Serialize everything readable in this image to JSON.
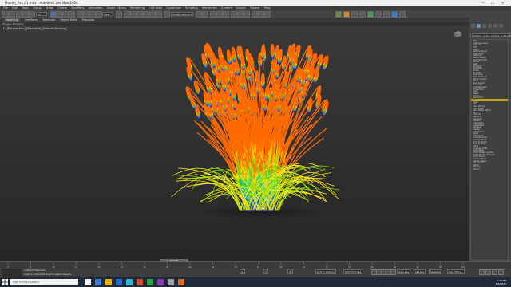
{
  "window": {
    "title": "Mantel_Grs_01.max - Autodesk 3ds Max 2020"
  },
  "menubar": {
    "items": [
      "File",
      "Edit",
      "Tools",
      "Group",
      "Views",
      "Create",
      "Modifiers",
      "Animation",
      "Graph Editors",
      "Rendering",
      "Civil View",
      "Customize",
      "Scripting",
      "Interactive",
      "Content",
      "Arnold",
      "Octane",
      "Help"
    ]
  },
  "toolbar": {
    "selection_filter": "All",
    "view_combo": "View",
    "selection_set": "Create Selection Se",
    "workspace": "Workspaces: Default"
  },
  "ribbon": {
    "tabs": [
      "Modeling",
      "Freeform",
      "Selection",
      "Object Paint",
      "Populate"
    ],
    "active": "Modeling",
    "sub": "Polygon Modeling"
  },
  "viewport": {
    "label": "[+] [Perspective] [Standard] [Default Shading]"
  },
  "command_panel": {
    "search_value": "Modifier_Grass_Octane_Subsampler",
    "list_items": [
      "Sky",
      "Displacement",
      "Extrude",
      "FFD",
      "Lathe",
      "Lattice Warp",
      "MapScaler",
      "Material",
      "Mesh Select",
      "MeshSmooth",
      "Mirror",
      "Melt",
      "Morpher",
      "MultiRes",
      "Noise",
      "Normal",
      "Optimize",
      "Path Deform",
      "Patch Select",
      "Pivot",
      "Poly Select",
      "Preserve",
      "ProOptimizer",
      "Projection",
      "Push",
      "Relax",
      "Ripple",
      "Selection",
      "Skew",
      "Shell",
      "Skin",
      "Skin Morph",
      "Skin Wrap",
      "Skin Wrap Patch",
      "Slice",
      "Smooth",
      "Spherify",
      "Squeeze",
      "Stretch",
      "Subdivide",
      "Substitute",
      "Surface",
      "Sweep",
      "Symmetry",
      "Taper",
      "Tessellate",
      "Turbosmooth",
      "Turn to Mesh",
      "Turn to Patch",
      "Turn to Poly",
      "Twist",
      "Unwrap UVW",
      "UVW Map",
      "UVW Mapping Add",
      "UVW Mapping Clear",
      "UVW Xform",
      "Vertex Paint",
      "Vertex Weld",
      "Vol. Select",
      "Wave",
      "Welder",
      "XForm"
    ],
    "selected_index": 28
  },
  "timeline": {
    "slider_label": "0 / 100",
    "ticks": [
      "0",
      "5",
      "10",
      "15",
      "20",
      "25",
      "30",
      "35",
      "40",
      "45",
      "50",
      "55",
      "60",
      "65",
      "70",
      "75",
      "80",
      "85",
      "90",
      "95",
      "100"
    ]
  },
  "status": {
    "selection": "1 Object Selected",
    "prompt": "Click or click-and-drag to select objects",
    "x_label": "X:",
    "y_label": "Y:",
    "z_label": "Z:",
    "grid": "Grid = 10,0cm",
    "add_time_tag": "Add Time Tag",
    "autokey": "Auto Key",
    "set_key": "Set Key",
    "selected": "Selected",
    "key_filters": "Key Filters..."
  },
  "taskbar": {
    "search_placeholder": "Type here to search",
    "time": "4:28 PM",
    "date": "4/9/2020",
    "app_colors": [
      "#ffffff",
      "#3a7bd5",
      "#e6b400",
      "#2b6ec9",
      "#2bb5d6",
      "#d04a2b",
      "#2e9e4a",
      "#8a3ab5",
      "#a0a0a0",
      "#e06a2b"
    ]
  }
}
